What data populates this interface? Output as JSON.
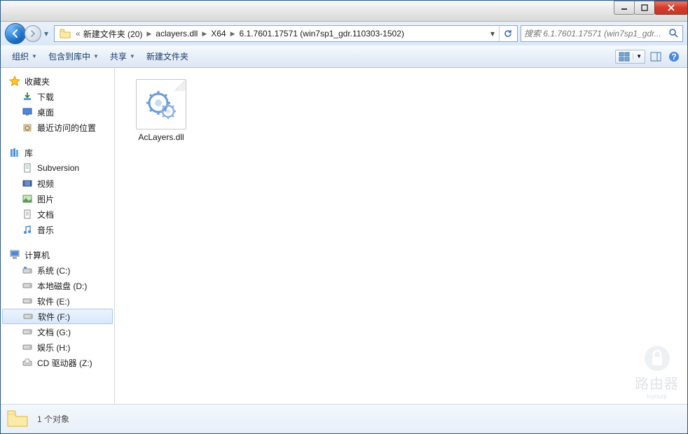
{
  "breadcrumb": {
    "prefix": "«",
    "items": [
      "新建文件夹 (20)",
      "aclayers.dll",
      "X64",
      "6.1.7601.17571 (win7sp1_gdr.110303-1502)"
    ]
  },
  "search": {
    "placeholder": "搜索 6.1.7601.17571 (win7sp1_gdr..."
  },
  "toolbar": {
    "organize": "组织",
    "include": "包含到库中",
    "share": "共享",
    "newfolder": "新建文件夹"
  },
  "sidebar": {
    "favorites": {
      "header": "收藏夹",
      "items": [
        "下载",
        "桌面",
        "最近访问的位置"
      ]
    },
    "libraries": {
      "header": "库",
      "items": [
        "Subversion",
        "视频",
        "图片",
        "文档",
        "音乐"
      ]
    },
    "computer": {
      "header": "计算机",
      "items": [
        "系统 (C:)",
        "本地磁盘 (D:)",
        "软件 (E:)",
        "软件 (F:)",
        "文档 (G:)",
        "娱乐 (H:)",
        "CD 驱动器 (Z:)"
      ],
      "selected": 3
    }
  },
  "content": {
    "files": [
      {
        "name": "AcLayers.dll"
      }
    ]
  },
  "status": {
    "text": "1 个对象"
  },
  "watermark": {
    "top": "路由器",
    "sub": "luyouqi"
  }
}
